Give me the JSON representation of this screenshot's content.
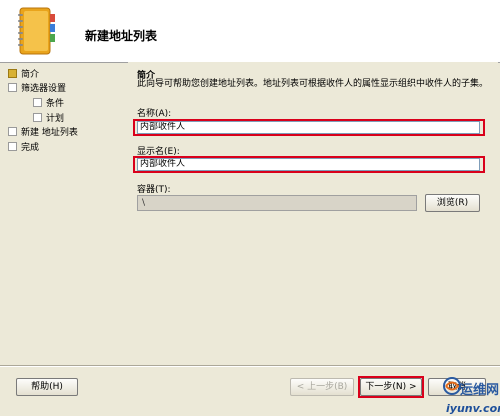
{
  "header": {
    "title": "新建地址列表",
    "icon": "address-book-icon"
  },
  "sidebar": {
    "items": [
      {
        "label": "简介",
        "state": "current"
      },
      {
        "label": "筛选器设置",
        "state": "pending"
      },
      {
        "label": "条件",
        "state": "pending"
      },
      {
        "label": "计划",
        "state": "pending"
      },
      {
        "label": "新建 地址列表",
        "state": "pending"
      },
      {
        "label": "完成",
        "state": "pending"
      }
    ]
  },
  "content": {
    "heading": "简介",
    "intro": "此向导可帮助您创建地址列表。地址列表可根据收件人的属性显示组织中收件人的子集。",
    "name_label": "名称(A):",
    "name_value": "内部收件人",
    "display_name_label": "显示名(E):",
    "display_name_value": "内部收件人",
    "container_label": "容器(T):",
    "container_value": "\\",
    "browse_label": "浏览(R)"
  },
  "footer": {
    "help_label": "帮助(H)",
    "back_label": "< 上一步(B)",
    "next_label": "下一步(N) >",
    "cancel_label": "取消"
  },
  "watermark": {
    "text": "运维网",
    "url": "iyunv.com"
  },
  "colors": {
    "background": "#ece9d8",
    "highlight": "#d9001b",
    "current_step": "#d8b133"
  }
}
